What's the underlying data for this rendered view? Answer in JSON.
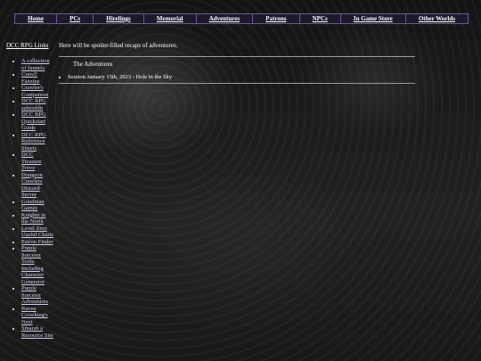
{
  "nav": [
    {
      "label": "Home"
    },
    {
      "label": "PCs"
    },
    {
      "label": "Hirelings"
    },
    {
      "label": "Memorial"
    },
    {
      "label": "Adventures"
    },
    {
      "label": "Patrons"
    },
    {
      "label": "NPCs"
    },
    {
      "label": "In Game Store"
    },
    {
      "label": "Other Worlds"
    }
  ],
  "sidebar": {
    "title": "DCC RPG Links",
    "links": [
      "A collection of funnels",
      "Crawl! Fanzine",
      "Crawler's Companion",
      "DCC RPG subreddit",
      "DCC RPG Quickstart Guide",
      "DCC RPG Reference Sheets",
      "DCC Treasure Trove",
      "Dungeon Crawlers Discord Server",
      "Goodman Games",
      "Knights in the North",
      "Level Zero Useful Charts",
      "Patron Finder",
      "Purple Sorcerer Tools Including Character Generator",
      "Purple Sorcerer Adventures",
      "Raven Crowking's Next",
      "Smarsh a Resource Site"
    ]
  },
  "main": {
    "intro": "Here will be spoiler-filled recaps of adventures.",
    "section_title": "The Adventures",
    "entries": [
      "Session January 15th, 2023 - Hole in the Sky"
    ]
  }
}
